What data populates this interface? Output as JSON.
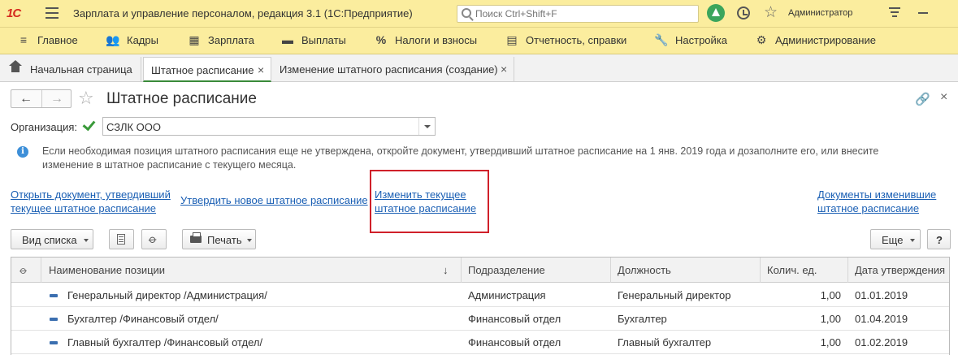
{
  "titlebar": {
    "logo": "1С",
    "title": "Зарплата и управление персоналом, редакция 3.1  (1С:Предприятие)",
    "search_placeholder": "Поиск Ctrl+Shift+F",
    "user": "Администратор"
  },
  "sections": [
    {
      "label": "Главное",
      "icon": "menu-icon"
    },
    {
      "label": "Кадры",
      "icon": "people-icon"
    },
    {
      "label": "Зарплата",
      "icon": "calculator-icon"
    },
    {
      "label": "Выплаты",
      "icon": "wallet-icon"
    },
    {
      "label": "Налоги и взносы",
      "icon": "percent-icon"
    },
    {
      "label": "Отчетность, справки",
      "icon": "reports-icon"
    },
    {
      "label": "Настройка",
      "icon": "wrench-icon"
    },
    {
      "label": "Администрирование",
      "icon": "gear-icon"
    }
  ],
  "tabs": [
    {
      "label": "Начальная страница"
    },
    {
      "label": "Штатное расписание"
    },
    {
      "label": "Изменение штатного расписания (создание)"
    }
  ],
  "form": {
    "title": "Штатное расписание",
    "org_label": "Организация:",
    "org_value": "СЗЛК ООО",
    "info": "Если необходимая позиция штатного расписания еще не утверждена, откройте документ, утвердивший штатное расписание на 1 янв. 2019 года и дозаполните его, или внесите изменение в штатное расписание с текущего месяца.",
    "links": {
      "open_doc_1": "Открыть документ, утвердивший",
      "open_doc_2": "текущее штатное расписание",
      "approve_new": "Утвердить новое штатное расписание",
      "change_current_1": "Изменить текущее",
      "change_current_2": "штатное расписание",
      "changed_docs_1": "Документы изменившие",
      "changed_docs_2": "штатное расписание"
    }
  },
  "toolbar": {
    "view_list": "Вид списка",
    "print": "Печать",
    "more": "Еще",
    "help": "?"
  },
  "table": {
    "headers": {
      "name": "Наименование позиции",
      "sort": "↓",
      "department": "Подразделение",
      "position": "Должность",
      "units": "Колич. ед.",
      "date": "Дата утверждения"
    },
    "rows": [
      {
        "name": "Генеральный директор /Администрация/",
        "department": "Администрация",
        "position": "Генеральный директор",
        "units": "1,00",
        "date": "01.01.2019"
      },
      {
        "name": "Бухгалтер /Финансовый отдел/",
        "department": "Финансовый отдел",
        "position": "Бухгалтер",
        "units": "1,00",
        "date": "01.04.2019"
      },
      {
        "name": "Главный бухгалтер /Финансовый отдел/",
        "department": "Финансовый отдел",
        "position": "Главный бухгалтер",
        "units": "1,00",
        "date": "01.02.2019"
      }
    ]
  }
}
